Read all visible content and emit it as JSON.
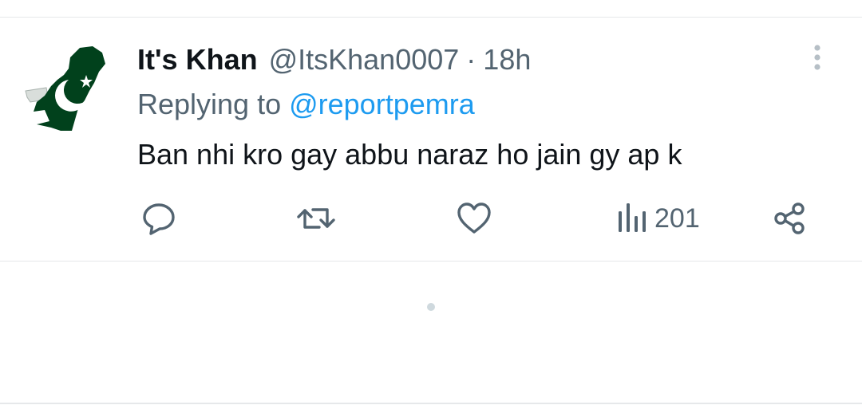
{
  "tweet": {
    "author_name": "It's Khan",
    "author_handle": "@ItsKhan0007",
    "separator": "·",
    "time": "18h",
    "reply_prefix": "Replying to ",
    "reply_to": "@reportpemra",
    "text": "Ban nhi kro gay abbu naraz ho jain gy ap k",
    "avatar_icon": "pakistan-flag-map",
    "more_icon": "more-vertical-icon"
  },
  "actions": {
    "reply_icon": "reply-icon",
    "retweet_icon": "retweet-icon",
    "like_icon": "like-icon",
    "views_icon": "views-icon",
    "views_count": "201",
    "share_icon": "share-icon"
  },
  "colors": {
    "text_primary": "#0f1419",
    "text_secondary": "#536471",
    "link": "#1d9bf0",
    "divider": "#e6e8ea",
    "flag_green": "#01411c"
  }
}
